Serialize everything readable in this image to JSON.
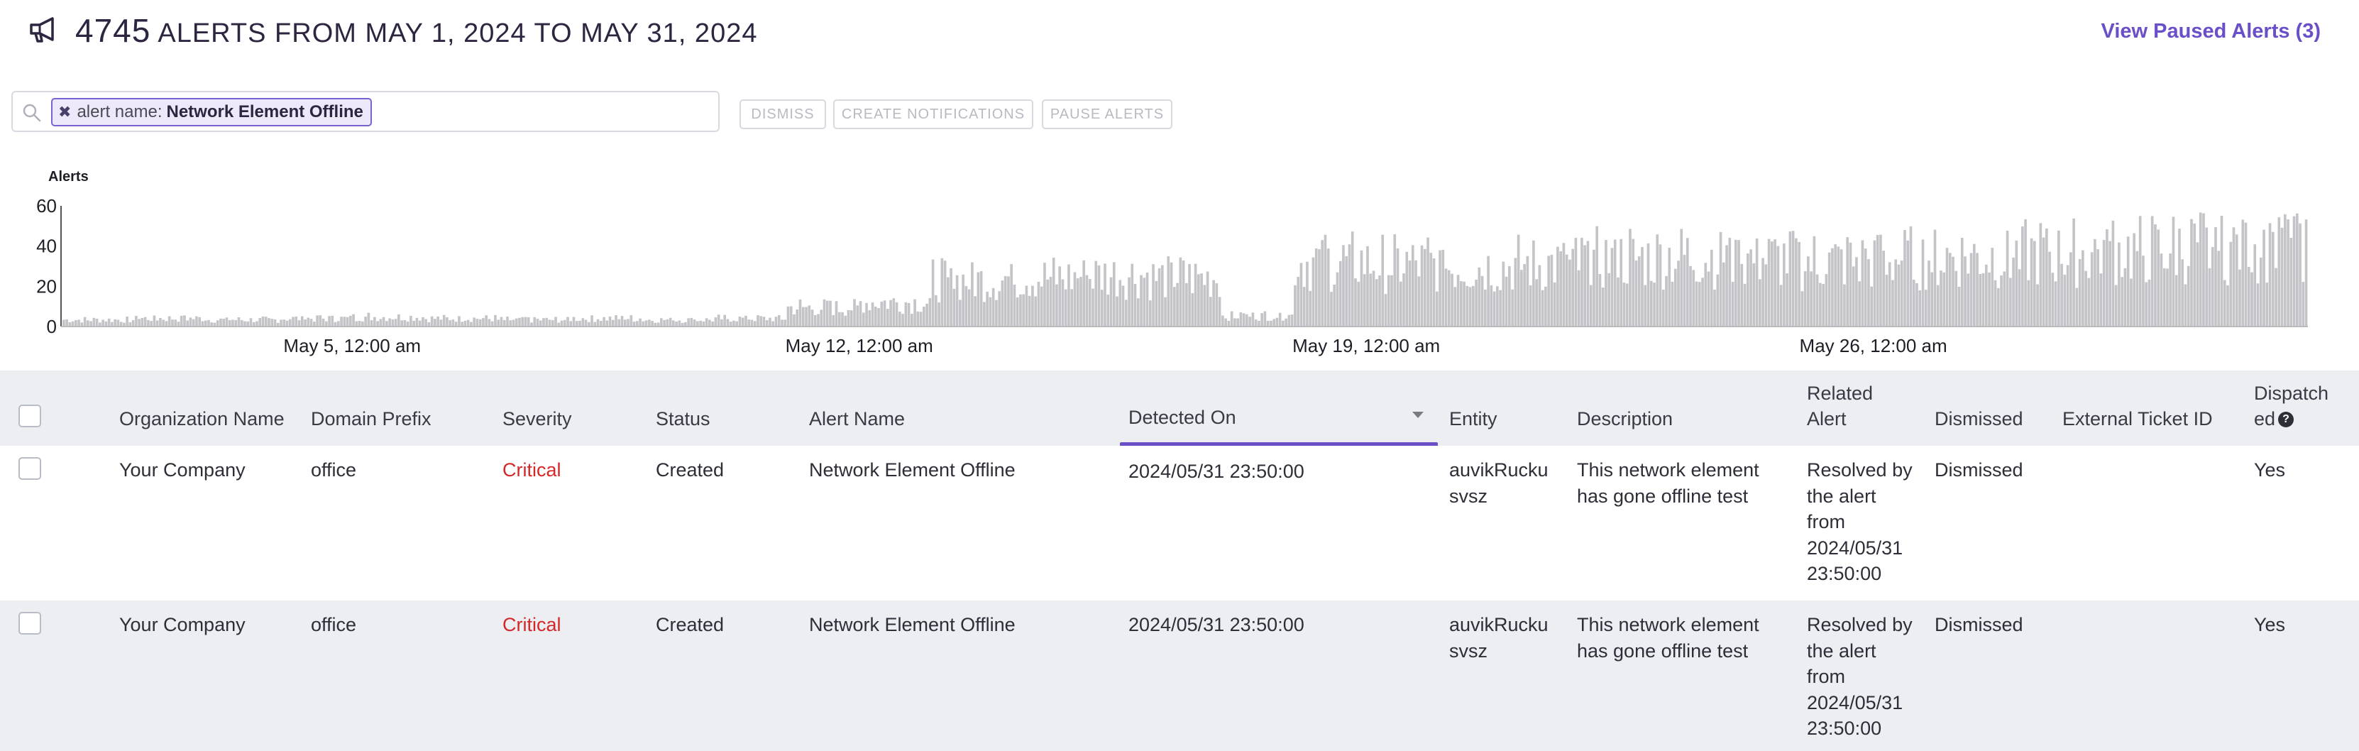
{
  "header": {
    "alert_count": "4745",
    "title_suffix": "ALERTS FROM MAY 1, 2024 TO MAY 31, 2024",
    "paused_link": "View Paused Alerts (3)"
  },
  "filter": {
    "chip_key": "alert name:",
    "chip_value": "Network Element Offline",
    "chip_remove": "✖"
  },
  "actions": {
    "dismiss": "DISMISS",
    "create_notifications": "CREATE NOTIFICATIONS",
    "pause_alerts": "PAUSE ALERTS"
  },
  "chart_data": {
    "type": "bar",
    "ylabel": "Alerts",
    "ylim": [
      0,
      60
    ],
    "y_ticks": [
      "0",
      "20",
      "40",
      "60"
    ],
    "x_tick_labels": [
      "May 5, 12:00 am",
      "May 12, 12:00 am",
      "May 19, 12:00 am",
      "May 26, 12:00 am"
    ],
    "x_range": [
      "2024-05-01 00:00",
      "2024-05-31 23:59"
    ],
    "bar_color": "#c4c4c8",
    "series": [
      {
        "x_start": "2024-05-01",
        "x_end": "2024-05-31",
        "daily_typical_peak": [
          5,
          6,
          5,
          6,
          7,
          6,
          5,
          6,
          5,
          6,
          14,
          18,
          34,
          36,
          38,
          36,
          8,
          48,
          46,
          44,
          46,
          50,
          52,
          50,
          48,
          50,
          52,
          54,
          56,
          58,
          60
        ]
      }
    ]
  },
  "table": {
    "columns": {
      "org": "Organization Name",
      "domain": "Domain Prefix",
      "severity": "Severity",
      "status": "Status",
      "alert_name": "Alert Name",
      "detected": "Detected On",
      "entity": "Entity",
      "description": "Description",
      "related_1": "Related",
      "related_2": "Alert",
      "dismissed": "Dismissed",
      "external_ticket": "External Ticket ID",
      "dispatched_1": "Dispatch",
      "dispatched_2": "ed"
    },
    "rows": [
      {
        "org": "Your Company",
        "domain": "office",
        "severity": "Critical",
        "status": "Created",
        "alert_name": "Network Element Offline",
        "detected": "2024/05/31 23:50:00",
        "entity_1": "auvikRucku",
        "entity_2": "svsz",
        "description_1": "This network element",
        "description_2": "has gone offline test",
        "related": [
          "Resolved by",
          "the alert",
          "from",
          "2024/05/31",
          "23:50:00"
        ],
        "dismissed": "Dismissed",
        "external_ticket": "",
        "dispatched": "Yes"
      },
      {
        "org": "Your Company",
        "domain": "office",
        "severity": "Critical",
        "status": "Created",
        "alert_name": "Network Element Offline",
        "detected": "2024/05/31 23:50:00",
        "entity_1": "auvikRucku",
        "entity_2": "svsz",
        "description_1": "This network element",
        "description_2": "has gone offline test",
        "related": [
          "Resolved by",
          "the alert",
          "from",
          "2024/05/31",
          "23:50:00"
        ],
        "dismissed": "Dismissed",
        "external_ticket": "",
        "dispatched": "Yes"
      }
    ]
  }
}
